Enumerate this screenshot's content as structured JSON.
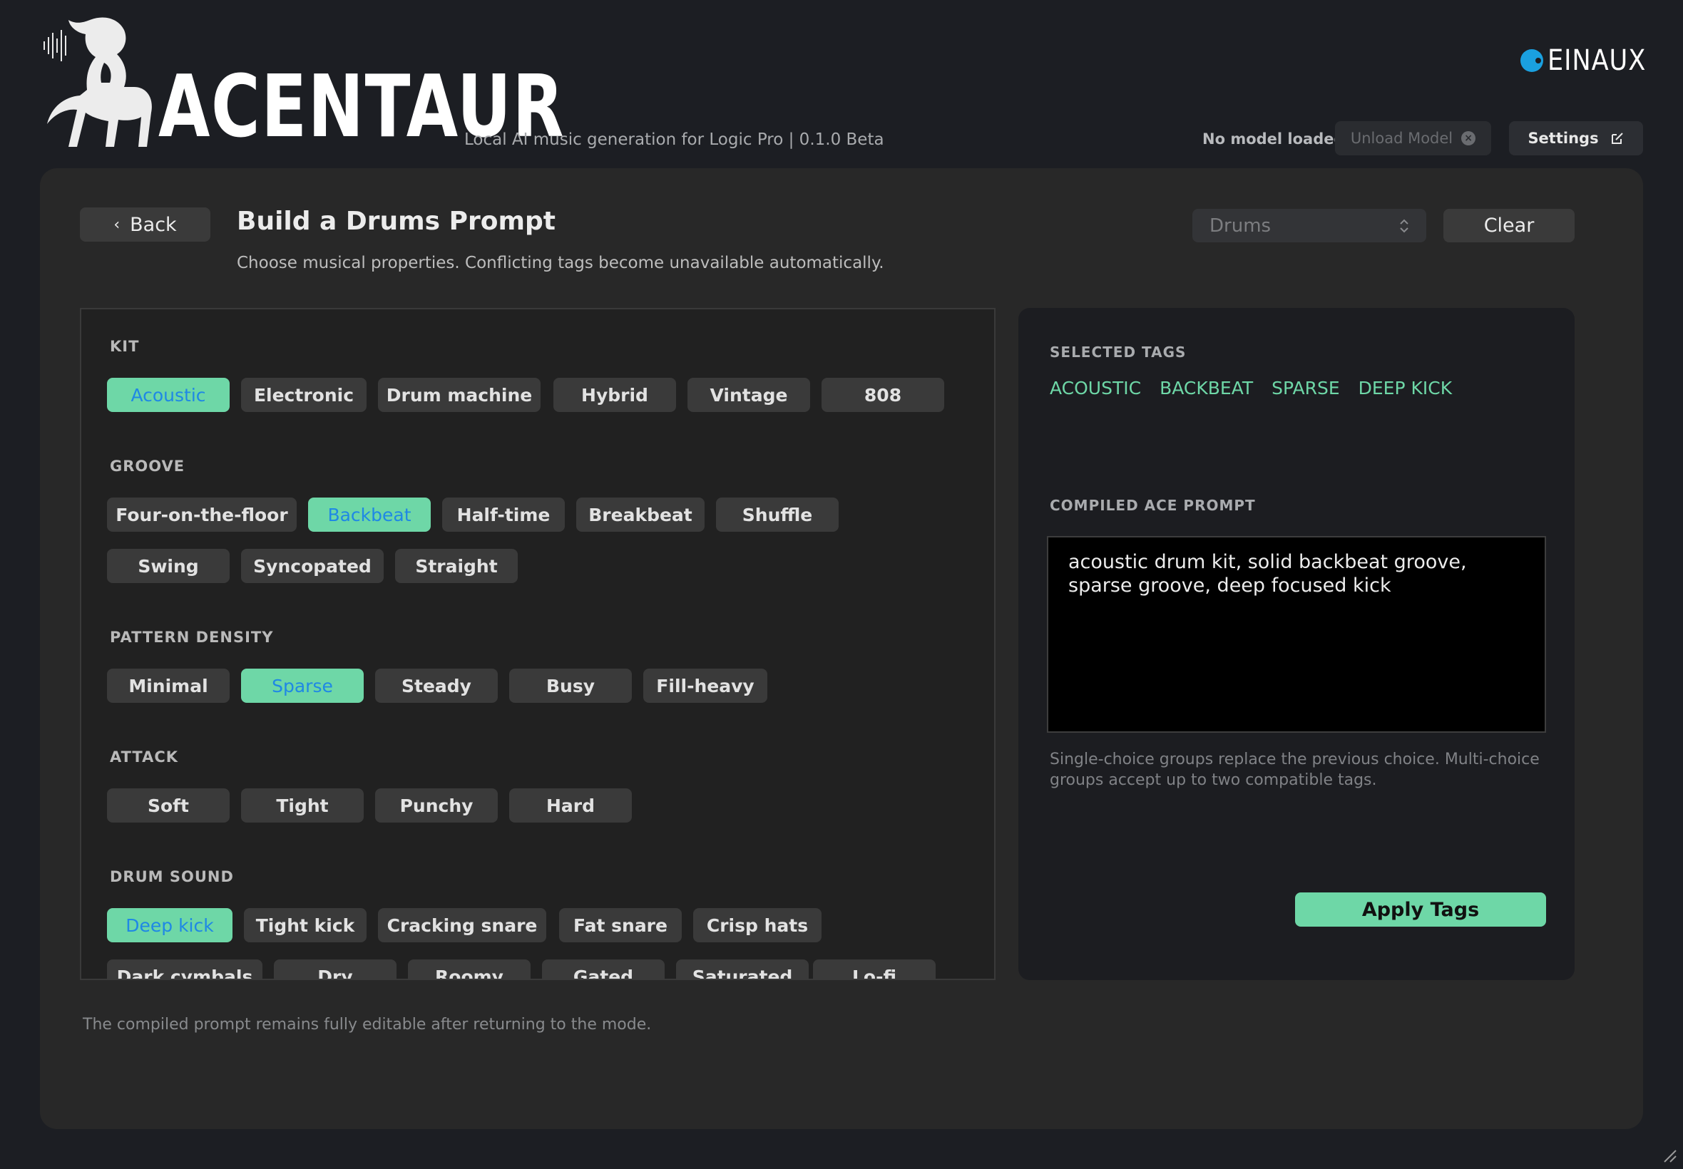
{
  "header": {
    "brand": "ACENTAUR",
    "subtitle": "Local AI music generation for Logic Pro | 0.1.0 Beta",
    "vendor": "EINAUX",
    "model_status": "No model loaded",
    "unload_label": "Unload Model",
    "settings_label": "Settings"
  },
  "page": {
    "back_label": "Back",
    "title": "Build a Drums Prompt",
    "description": "Choose musical properties. Conflicting tags become unavailable automatically.",
    "mode_value": "Drums",
    "clear_label": "Clear",
    "footer_note": "The compiled prompt remains fully editable after returning to the mode."
  },
  "groups": [
    {
      "label": "KIT",
      "tags": [
        {
          "label": "Acoustic",
          "selected": true
        },
        {
          "label": "Electronic",
          "selected": false
        },
        {
          "label": "Drum machine",
          "selected": false
        },
        {
          "label": "Hybrid",
          "selected": false
        },
        {
          "label": "Vintage",
          "selected": false
        },
        {
          "label": "808",
          "selected": false
        }
      ]
    },
    {
      "label": "GROOVE",
      "tags": [
        {
          "label": "Four-on-the-floor",
          "selected": false
        },
        {
          "label": "Backbeat",
          "selected": true
        },
        {
          "label": "Half-time",
          "selected": false
        },
        {
          "label": "Breakbeat",
          "selected": false
        },
        {
          "label": "Shuffle",
          "selected": false
        },
        {
          "label": "Swing",
          "selected": false
        },
        {
          "label": "Syncopated",
          "selected": false
        },
        {
          "label": "Straight",
          "selected": false
        }
      ]
    },
    {
      "label": "PATTERN DENSITY",
      "tags": [
        {
          "label": "Minimal",
          "selected": false
        },
        {
          "label": "Sparse",
          "selected": true
        },
        {
          "label": "Steady",
          "selected": false
        },
        {
          "label": "Busy",
          "selected": false
        },
        {
          "label": "Fill-heavy",
          "selected": false
        }
      ]
    },
    {
      "label": "ATTACK",
      "tags": [
        {
          "label": "Soft",
          "selected": false
        },
        {
          "label": "Tight",
          "selected": false
        },
        {
          "label": "Punchy",
          "selected": false
        },
        {
          "label": "Hard",
          "selected": false
        }
      ]
    },
    {
      "label": "DRUM SOUND",
      "tags": [
        {
          "label": "Deep kick",
          "selected": true
        },
        {
          "label": "Tight kick",
          "selected": false
        },
        {
          "label": "Cracking snare",
          "selected": false
        },
        {
          "label": "Fat snare",
          "selected": false
        },
        {
          "label": "Crisp hats",
          "selected": false
        },
        {
          "label": "Dark cymbals",
          "selected": false
        },
        {
          "label": "Dry",
          "selected": false
        },
        {
          "label": "Roomy",
          "selected": false
        },
        {
          "label": "Gated",
          "selected": false
        },
        {
          "label": "Saturated",
          "selected": false
        },
        {
          "label": "Lo-fi",
          "selected": false
        }
      ]
    }
  ],
  "summary": {
    "selected_label": "SELECTED TAGS",
    "selected_tags": [
      "ACOUSTIC",
      "BACKBEAT",
      "SPARSE",
      "DEEP KICK"
    ],
    "compiled_label": "COMPILED ACE PROMPT",
    "compiled_prompt": "acoustic drum kit, solid backbeat groove, sparse groove, deep focused kick",
    "note": "Single-choice groups replace the previous choice. Multi-choice groups accept up to two compatible tags.",
    "apply_label": "Apply Tags"
  },
  "colors": {
    "accent": "#6ed7a7",
    "selected_text": "#1f88e5",
    "background": "#1c1e23",
    "panel": "#282828",
    "vendor_dot": "#1aa0e0"
  },
  "icons": [
    "centaur-logo",
    "einaux-logo-icon",
    "close-circle-icon",
    "external-edit-icon",
    "chevron-left-icon",
    "updown-chevron-icon",
    "resize-grip-icon"
  ]
}
